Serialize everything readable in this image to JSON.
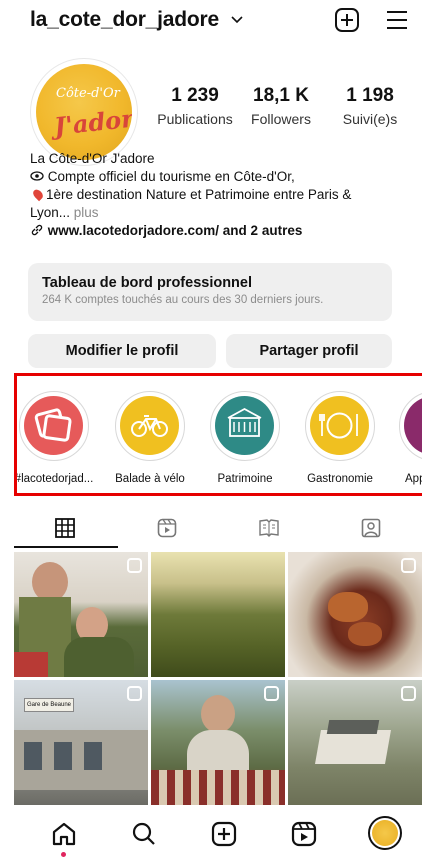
{
  "header": {
    "username": "la_cote_dor_jadore",
    "icons": [
      "chevron-down-icon",
      "plus-square-icon",
      "menu-icon"
    ]
  },
  "profile": {
    "avatar_text_top": "Côte-d'Or",
    "avatar_text_bottom": "J'adore",
    "stats": [
      {
        "value": "1 239",
        "label": "Publications"
      },
      {
        "value": "18,1 K",
        "label": "Followers"
      },
      {
        "value": "1 198",
        "label": "Suivi(e)s"
      }
    ],
    "bio": {
      "name": "La Côte-d'Or J'adore",
      "line1": "Compte officiel du tourisme en Côte-d'Or,",
      "line2": "1ère destination Nature et Patrimoine entre Paris &",
      "line3": "Lyon...",
      "more": "plus",
      "link": "www.lacotedorjadore.com/ and 2 autres"
    }
  },
  "dashboard": {
    "title": "Tableau de bord professionnel",
    "subtitle": "264 K comptes touchés au cours des 30 derniers jours."
  },
  "buttons": {
    "edit": "Modifier le profil",
    "share": "Partager profil"
  },
  "highlights": [
    {
      "label": "#lacotedorjad...",
      "color": "#e65a5a",
      "icon": "photos-icon"
    },
    {
      "label": "Balade à vélo",
      "color": "#f0c020",
      "icon": "bicycle-icon"
    },
    {
      "label": "Patrimoine",
      "color": "#2e8a86",
      "icon": "building-icon"
    },
    {
      "label": "Gastronomie",
      "color": "#f0c020",
      "icon": "plate-icon"
    },
    {
      "label": "App",
      "color": "#8a2a6a",
      "icon": "app-icon"
    }
  ],
  "tabs": [
    "grid-icon",
    "reels-icon",
    "guides-icon",
    "tagged-icon"
  ],
  "bottom_nav": [
    "home-icon",
    "search-icon",
    "create-icon",
    "reels-icon",
    "profile-avatar"
  ],
  "grid_text": {
    "sign": "Gare de Beaune"
  },
  "colors": {
    "highlight_border": "#e60000",
    "notification_dot": "#e0245e"
  }
}
